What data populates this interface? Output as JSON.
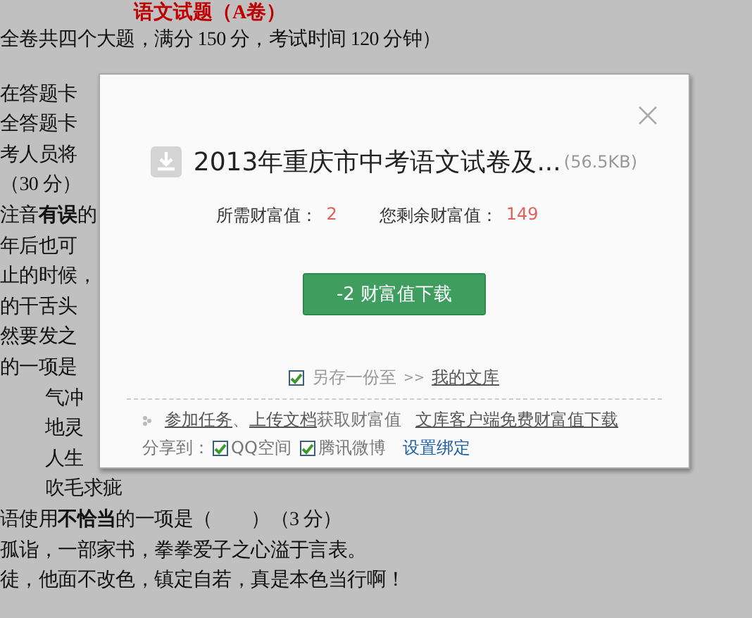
{
  "document": {
    "title": "语文试题（A卷）",
    "lines": [
      {
        "kind": "text",
        "text": "全卷共四个大题，满分 150 分，考试时间 120 分钟）"
      },
      {
        "kind": "gap",
        "text": "在答题卡"
      },
      {
        "kind": "text",
        "text": "全答题卡"
      },
      {
        "kind": "text",
        "text": "考人员将"
      },
      {
        "kind": "text",
        "text": "（30 分）"
      },
      {
        "kind": "text",
        "text": "注音**有误**的"
      },
      {
        "kind": "text",
        "text": "年后也可"
      },
      {
        "kind": "text",
        "text": "止的时候，"
      },
      {
        "kind": "text",
        "text": "的干舌头"
      },
      {
        "kind": "text",
        "text": "然要发之"
      },
      {
        "kind": "text",
        "text": "的一项是"
      },
      {
        "kind": "option",
        "text": "气冲"
      },
      {
        "kind": "option",
        "text": "地灵"
      },
      {
        "kind": "option",
        "text": "人生"
      },
      {
        "kind": "option",
        "text": "吹毛求疵"
      },
      {
        "kind": "text",
        "text": "语使用**不恰当**的一项是（　　）（3 分）"
      },
      {
        "kind": "text",
        "text": "孤诣，一部家书，拳拳爱子之心溢于言表。"
      },
      {
        "kind": "text",
        "text": "徒，他面不改色，镇定自若，真是本色当行啊！"
      }
    ]
  },
  "dialog": {
    "title": "2013年重庆市中考语文试卷及...",
    "size": "(56.5KB)",
    "cost_label": "所需财富值：",
    "cost": "2",
    "balance_label": "您剩余财富值：",
    "balance": "149",
    "button": "-2 财富值下载",
    "save": {
      "checked": true,
      "label": "另存一份至",
      "arrows": ">>",
      "link": "我的文库"
    },
    "tasks": [
      {
        "kind": "link",
        "text": "参加任务"
      },
      {
        "kind": "text",
        "text": "、"
      },
      {
        "kind": "link",
        "text": "上传文档"
      },
      {
        "kind": "text",
        "text": "获取财富值"
      },
      {
        "kind": "spacer_link",
        "text": "文库客户端免费财富值下载"
      }
    ],
    "share": {
      "label": "分享到：",
      "targets": [
        {
          "label": "QQ空间",
          "checked": true
        },
        {
          "label": "腾讯微博",
          "checked": true
        }
      ],
      "bind_link": "设置绑定"
    }
  }
}
